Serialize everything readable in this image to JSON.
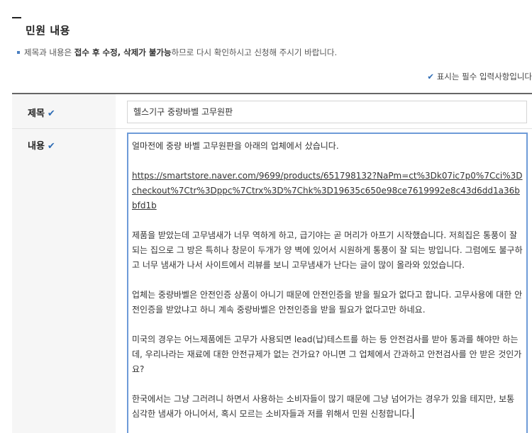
{
  "section": {
    "title": "민원 내용"
  },
  "notice": {
    "prefix": "제목과 내용은 ",
    "bold": "접수 후 수정, 삭제가 불가능",
    "suffix": "하므로 다시 확인하시고 신청해 주시기 바랍니다."
  },
  "required_note": {
    "text": "표시는 필수 입력사항입니다"
  },
  "form": {
    "title_label": "제목",
    "title_value": "헬스기구 중량바벨 고무원판",
    "content_label": "내용",
    "content": {
      "p1": "얼마전에 중량 바벨 고무원판을 아래의 업체에서 샀습니다.",
      "url": "https://smartstore.naver.com/9699/products/651798132?NaPm=ct%3Dk07ic7p0%7Cci%3Dcheckout%7Ctr%3Dppc%7Ctrx%3D%7Chk%3D19635c650e98ce7619992e8c43d6dd1a36bbfd1b",
      "p3": "제품을 받았는데 고무냄새가 너무 역하게 하고, 급기야는 곧 머리가 아프기 시작했습니다. 저희집은 통풍이 잘 되는 집으로 그 방은 특히나 창문이 두개가 양 벽에 있어서 시원하게 통풍이 잘 되는 방입니다. 그럼에도 불구하고 너무 냄새가 나서 사이트에서 리뷰를 보니 고무냄새가 난다는 글이 많이 올라와 있었습니다.",
      "p4": "업체는 중량바벨은 안전인증 상품이 아니기 때문에 안전인증을 받을 필요가 없다고 합니다. 고무사용에 대한 안전인증을 받았냐고 하니 계속 중량바벨은 안전인증을 받을 필요가 없다고만 하네요.",
      "p5": "미국의 경우는 어느제품에든 고무가 사용되면 lead(납)테스트를 하는 등 안전검사를 받아 통과를 해야만 하는데, 우리나라는 재료에 대한 안전규제가 없는 건가요? 아니면 그 업체에서 간과하고 안전검사를 안 받은 것인가요?",
      "p6": "한국에서는 그냥 그러려니 하면서 사용하는 소비자들이 많기 때문에 그냥 넘어가는 경우가 있을 테지만, 보통 심각한 냄새가 아니어서, 혹시 모르는 소비자들과 저를 위해서 민원 신청합니다."
    }
  },
  "colors": {
    "accent": "#2f6db5",
    "focus_border": "#6e9bd8",
    "label_bg": "#f6f6f6"
  },
  "icons": {
    "required": "checkmark-icon"
  }
}
